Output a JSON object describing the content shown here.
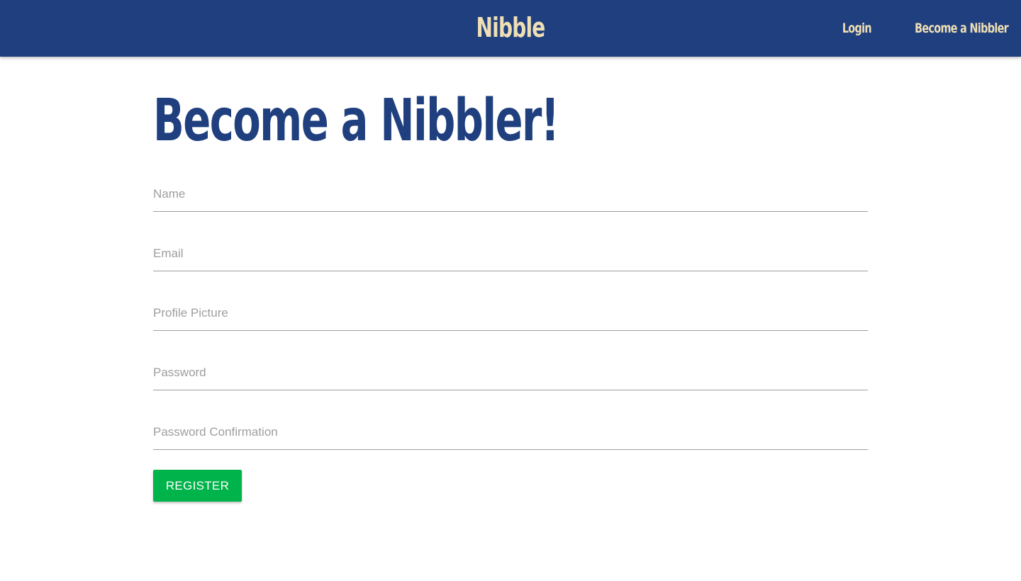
{
  "navbar": {
    "brand": "Nibble",
    "links": [
      {
        "label": "Login"
      },
      {
        "label": "Become a Nibbler"
      }
    ]
  },
  "page": {
    "title": "Become a Nibbler!"
  },
  "form": {
    "fields": [
      {
        "placeholder": "Name",
        "value": ""
      },
      {
        "placeholder": "Email",
        "value": ""
      },
      {
        "placeholder": "Profile Picture",
        "value": ""
      },
      {
        "placeholder": "Password",
        "value": ""
      },
      {
        "placeholder": "Password Confirmation",
        "value": ""
      }
    ],
    "submit_label": "REGISTER"
  },
  "colors": {
    "navbar_bg": "#1f3f7f",
    "brand_text": "#efdfb4",
    "title_text": "#1f3f7f",
    "button_bg": "#00b34a"
  }
}
